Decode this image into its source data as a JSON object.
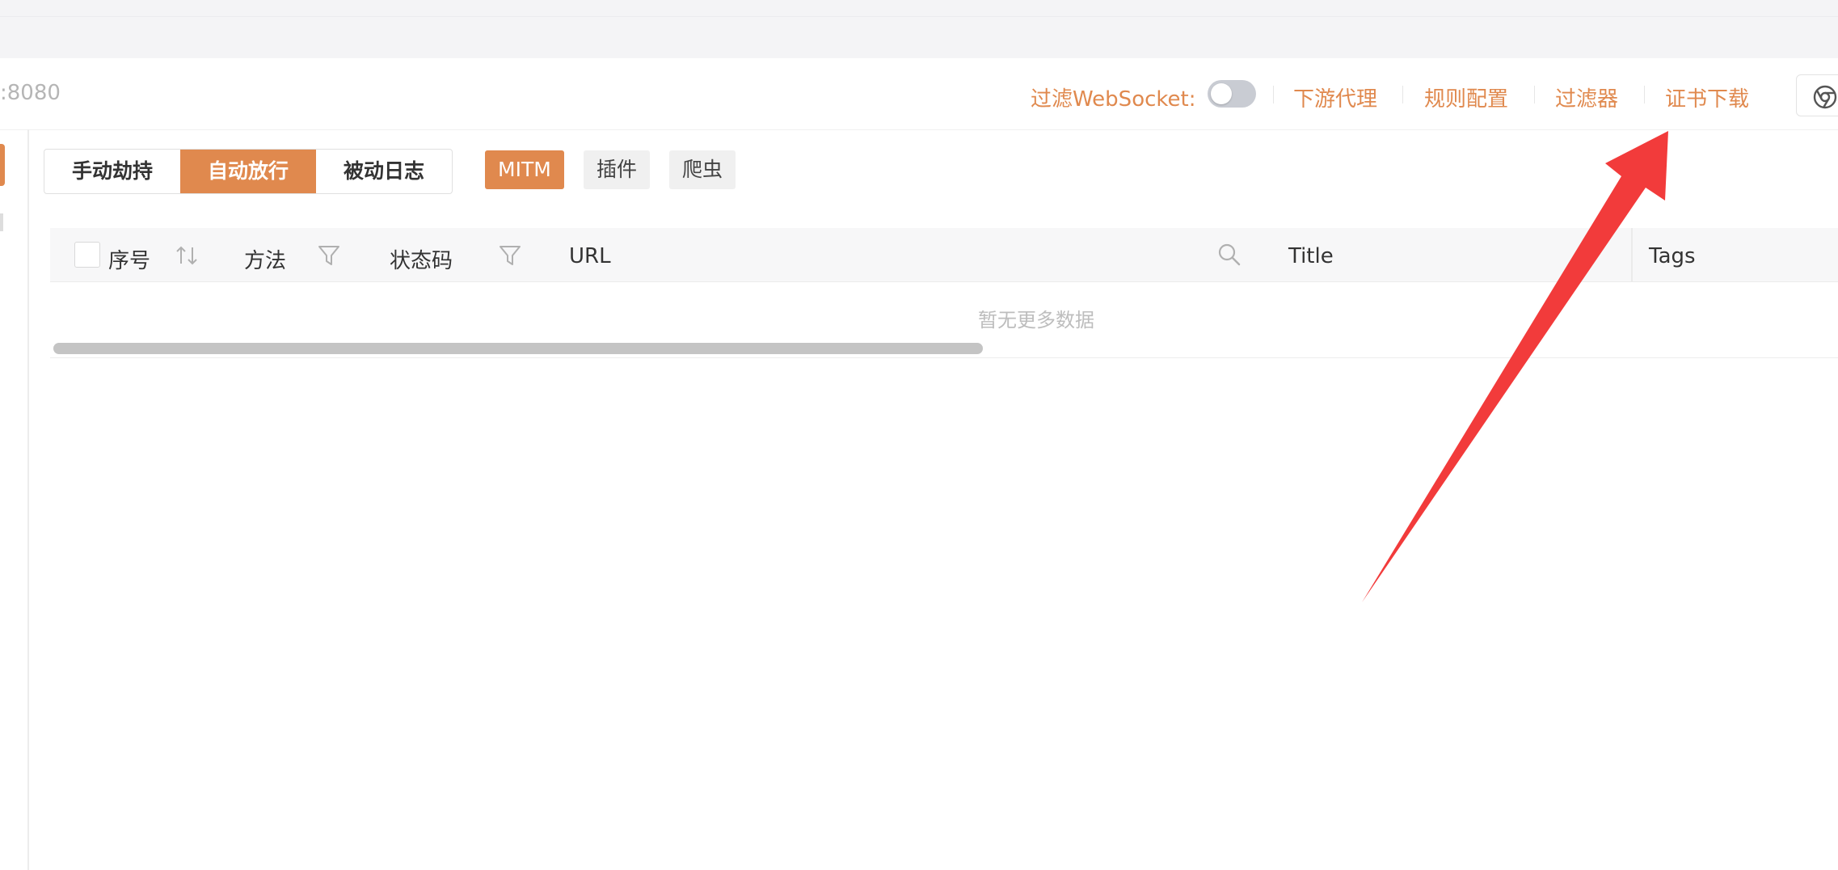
{
  "toolbar": {
    "host": ":8080",
    "ws_label": "过滤WebSocket:",
    "links": [
      "下游代理",
      "规则配置",
      "过滤器",
      "证书下载"
    ]
  },
  "modes": [
    "手动劫持",
    "自动放行",
    "被动日志"
  ],
  "active_mode": "自动放行",
  "tags": [
    "MITM",
    "插件",
    "爬虫"
  ],
  "table": {
    "columns": [
      "序号",
      "方法",
      "状态码",
      "URL",
      "Title",
      "Tags"
    ],
    "empty_text": "暂无更多数据"
  },
  "colors": {
    "accent": "#e0894e",
    "annotation_arrow": "#f23b3b"
  },
  "icons": [
    "sort-icon",
    "filter-icon",
    "search-icon",
    "chrome-icon"
  ]
}
